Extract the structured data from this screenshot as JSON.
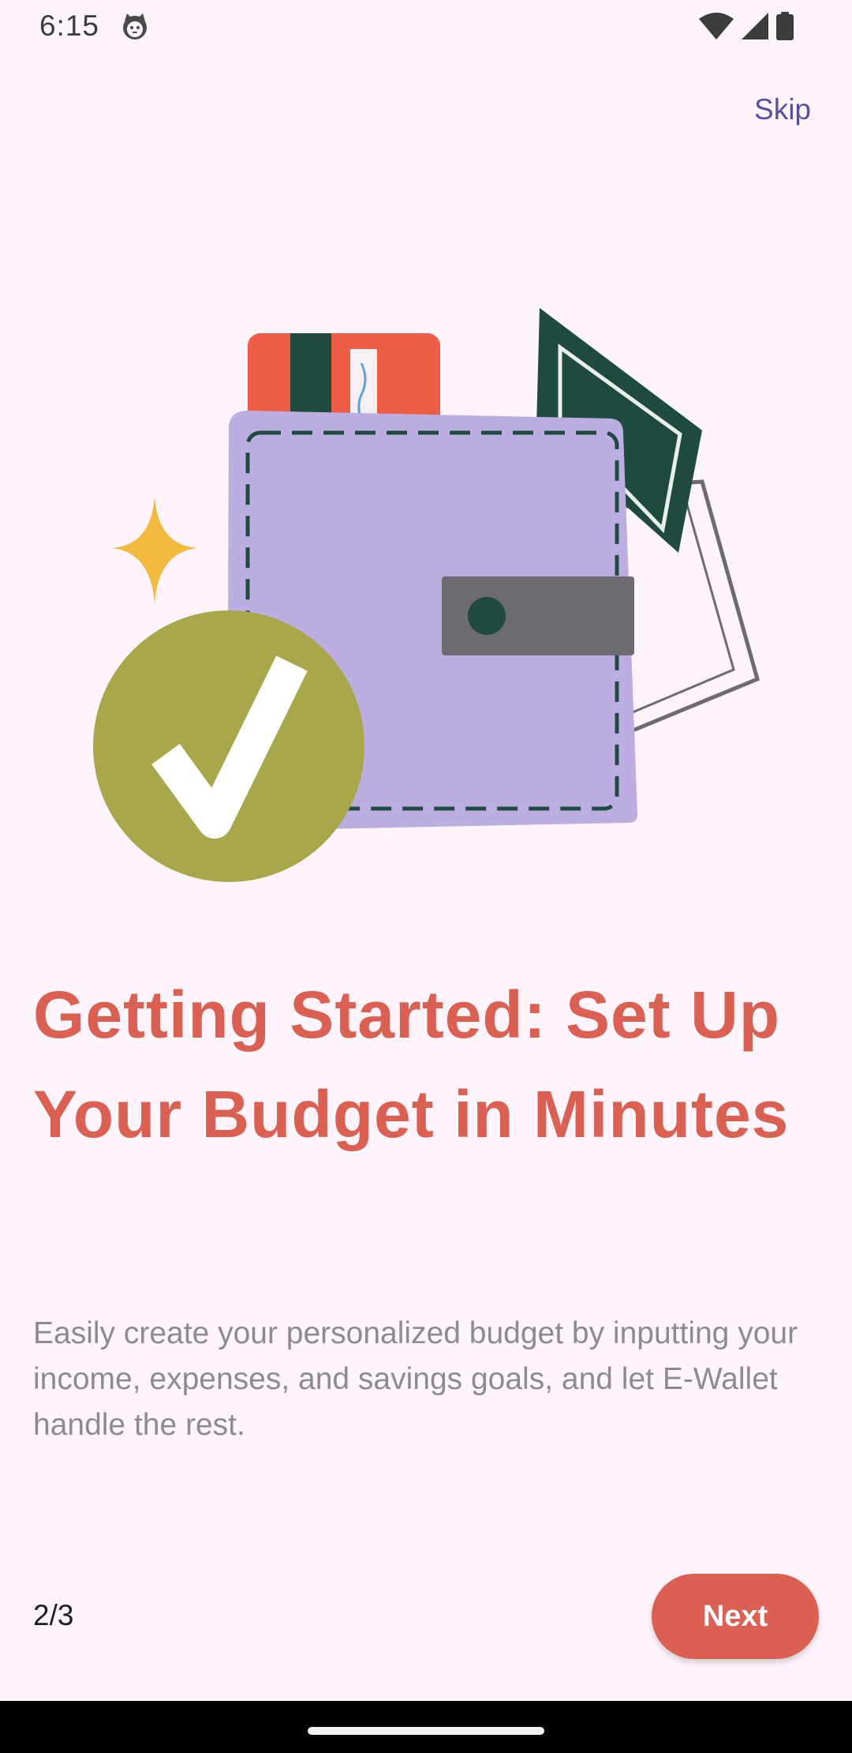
{
  "status_bar": {
    "time": "6:15",
    "app_icon": "cat-face-icon",
    "wifi_icon": "wifi-icon",
    "signal_icon": "signal-icon",
    "battery_icon": "battery-icon"
  },
  "header": {
    "skip_label": "Skip"
  },
  "illustration": {
    "icon": "wallet-with-checkmark-illustration",
    "colors": {
      "wallet": "#bcaee0",
      "card": "#ef5d47",
      "bill": "#1f4a40",
      "check_circle": "#a8a74a",
      "sparkle": "#f2bb3f"
    }
  },
  "content": {
    "headline": "Getting Started: Set Up Your Budget in Minutes",
    "description": "Easily create your personalized budget by inputting your income, expenses, and savings goals, and let E-Wallet handle the rest."
  },
  "footer": {
    "page_indicator": "2/3",
    "next_label": "Next"
  },
  "colors": {
    "accent": "#dc6052",
    "skip": "#5b4ea3",
    "background": "#fdf5fb"
  }
}
